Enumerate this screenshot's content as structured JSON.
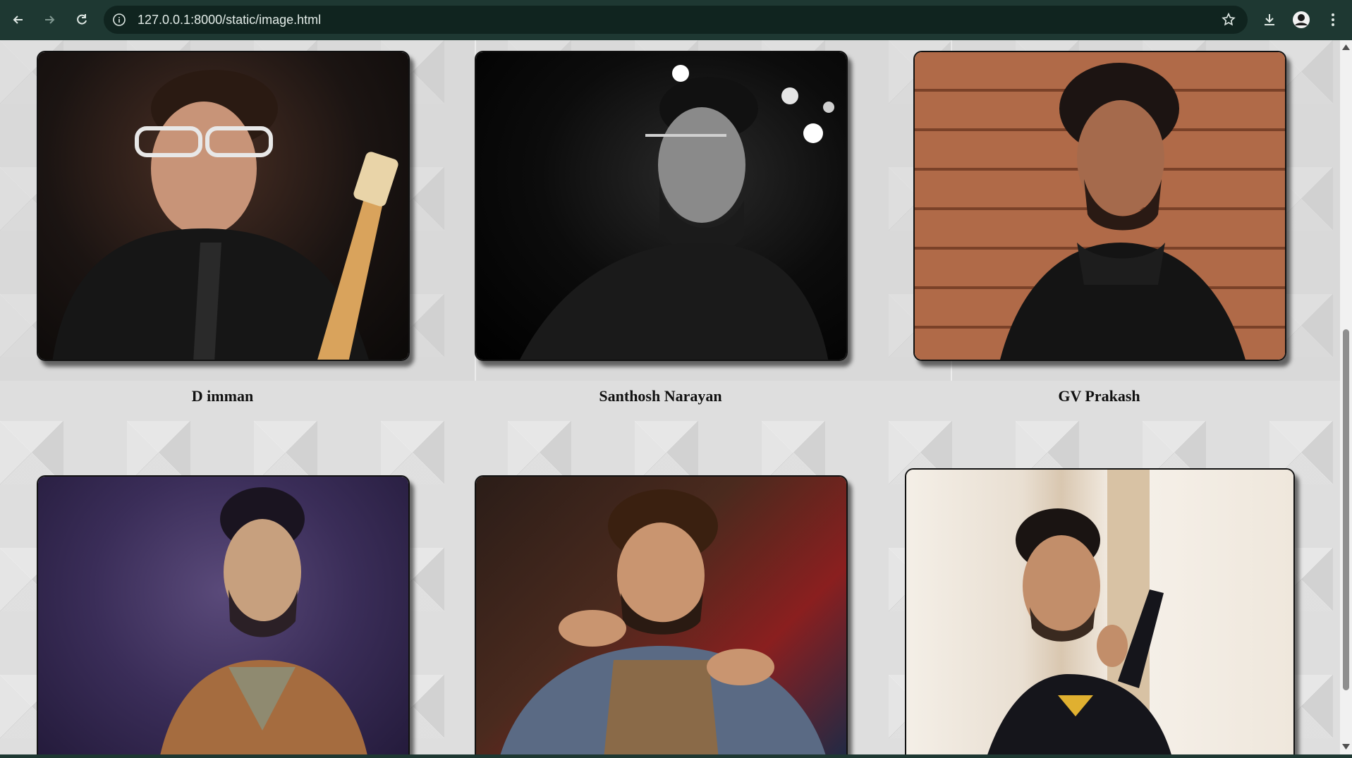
{
  "browser": {
    "url": "127.0.0.1:8000/static/image.html",
    "icons": {
      "back": "arrow-left-icon",
      "forward": "arrow-right-icon",
      "reload": "reload-icon",
      "info": "info-icon",
      "bookmark": "star-icon",
      "download": "download-icon",
      "profile": "avatar-icon",
      "menu": "kebab-menu-icon"
    },
    "colors": {
      "toolbar": "#1e3832",
      "omnibox": "#10241f",
      "text": "#e3ece8"
    }
  },
  "gallery": {
    "cards": [
      {
        "name": "D imman",
        "photo_desc": "man with glasses holding guitar"
      },
      {
        "name": "Santhosh Narayan",
        "photo_desc": "black and white bearded man laughing"
      },
      {
        "name": "GV Prakash",
        "photo_desc": "man in hoodie against wooden wall"
      },
      {
        "name": "",
        "photo_desc": "man in purple-lit portrait"
      },
      {
        "name": "",
        "photo_desc": "curly haired man pointing"
      },
      {
        "name": "",
        "photo_desc": "young man leaning on pillar"
      }
    ]
  }
}
